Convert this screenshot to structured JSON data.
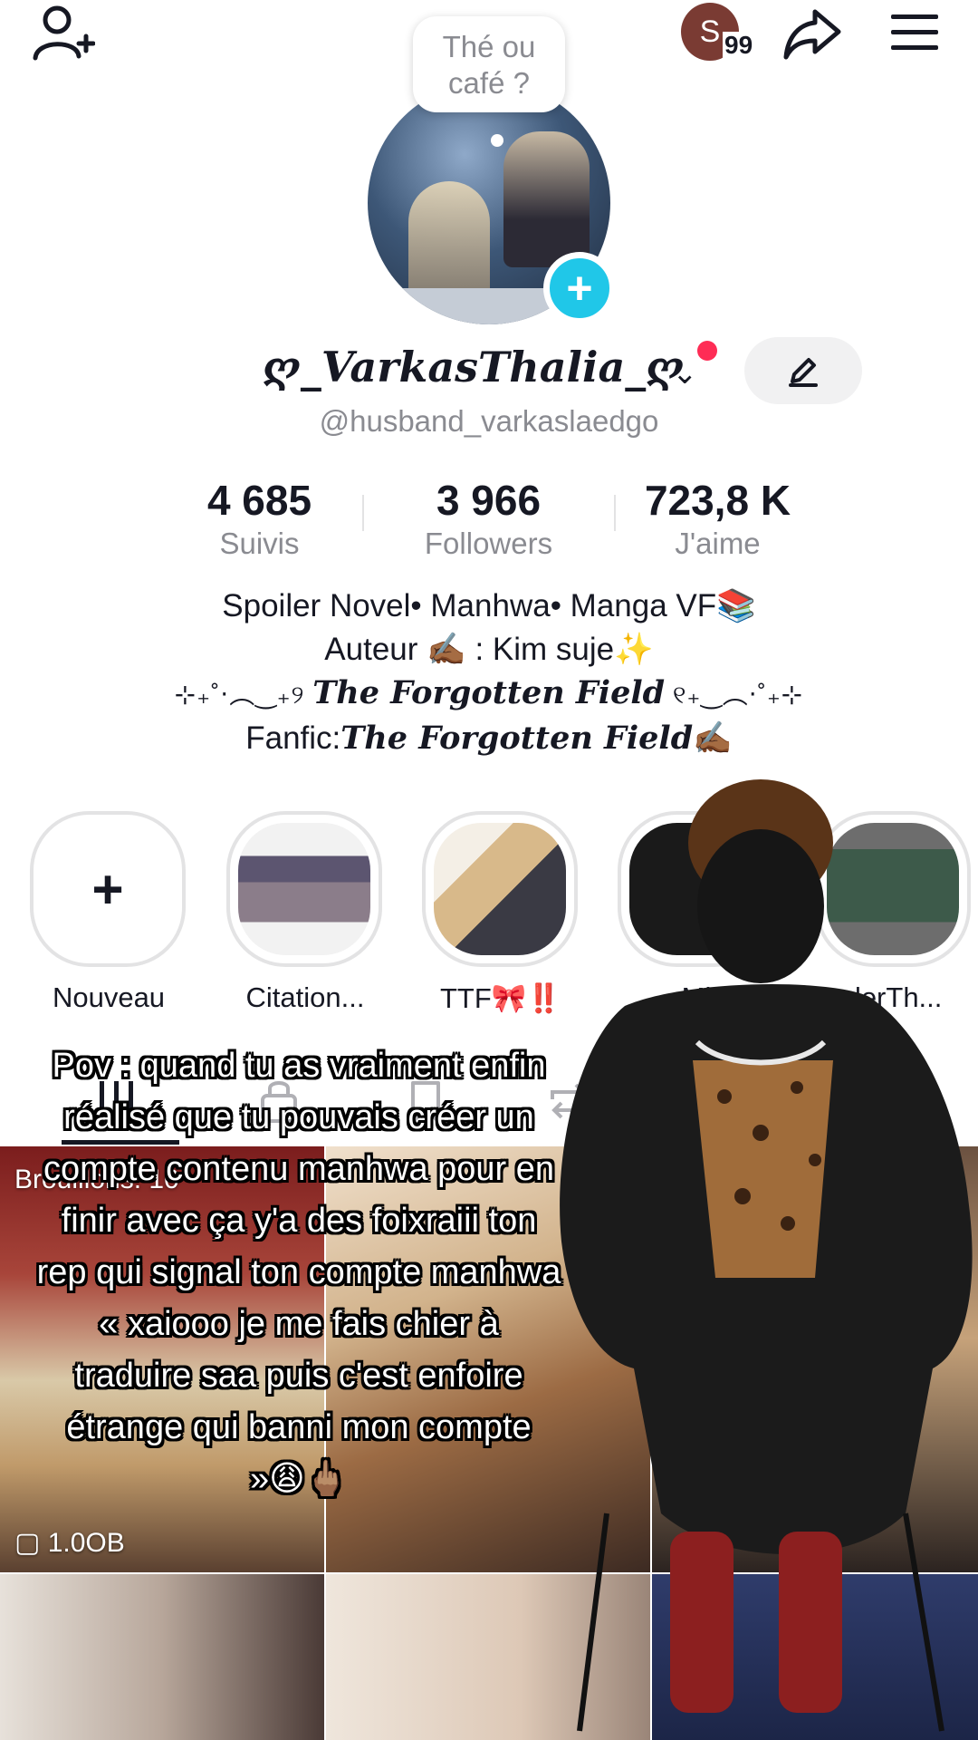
{
  "header": {
    "coin_letter": "S",
    "coin_count": "99",
    "bubble_text": "Thé ou café ?"
  },
  "profile": {
    "display_name": "ღ_VarkasThalia_ღ",
    "username": "@husband_varkaslaedgo"
  },
  "stats": [
    {
      "value": "4 685",
      "label": "Suivis"
    },
    {
      "value": "3 966",
      "label": "Followers"
    },
    {
      "value": "723,8 K",
      "label": "J'aime"
    }
  ],
  "bio": {
    "line1": "Spoiler Novel• Manhwa• Manga VF📚",
    "line2": "Auteur ✍🏾 : Kim suje✨",
    "line3_prefix": "⊹₊˚‧︵‿₊୨ ",
    "line3_title": "The Forgotten Field",
    "line3_suffix": " ୧₊‿︵‧˚₊⊹",
    "line4_prefix": "Fanfic:",
    "line4_title": "The Forgotten Field",
    "line4_suffix": "✍🏾"
  },
  "highlights": [
    {
      "label": "Nouveau"
    },
    {
      "label": "Citation..."
    },
    {
      "label": "TTF🎀‼️"
    },
    {
      "label": "Ml"
    },
    {
      "label": "derTh..."
    }
  ],
  "grid": {
    "drafts_label": "Brouillons: 10",
    "views_label": "1.0OB"
  },
  "overlay": {
    "caption": "Pov : quand tu as vraiment enfin réalisé que tu pouvais créer un compte contenu manhwa pour en finir avec ça y'a des foixraiii ton rep qui signal ton compte manhwa « xaiooo je me fais chier à traduire saa puis c'est enfoire étrange qui banni mon compte »😩🖕🏽"
  },
  "colors": {
    "accent_cyan": "#20c7e8",
    "notification_red": "#fe2c55",
    "text_primary": "#161823",
    "text_secondary": "#8a8b91"
  }
}
